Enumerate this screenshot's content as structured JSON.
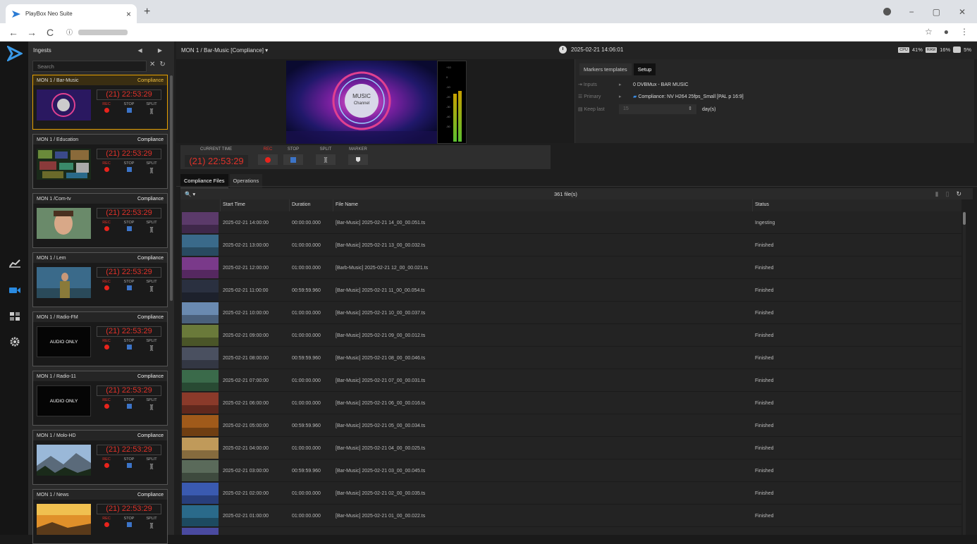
{
  "browser": {
    "tab_title": "PlayBox Neo Suite",
    "new_tab": "+",
    "close_tab": "×",
    "back": "←",
    "forward": "→",
    "reload": "C",
    "info": "ⓘ",
    "minimize": "−",
    "restore": "▢",
    "close": "✕",
    "star": "☆",
    "menu": "⋮"
  },
  "ingests": {
    "title": "Ingests",
    "arrows": "◀ ▶",
    "search_placeholder": "Search",
    "rec_label": "REC",
    "stop_label": "STOP",
    "split_label": "SPLIT",
    "split_symbol": "][",
    "cards": [
      {
        "name": "MON 1 / Bar-Music",
        "mode": "Compliance",
        "timer": "(21) 22:53:29",
        "active": true,
        "audio_only": false,
        "thumb": "music"
      },
      {
        "name": "MON 1 / Education",
        "mode": "Compliance",
        "timer": "(21) 22:53:29",
        "active": false,
        "audio_only": false,
        "thumb": "mosaic"
      },
      {
        "name": "MON 1 /Com-tv",
        "mode": "Compliance",
        "timer": "(21) 22:53:29",
        "active": false,
        "audio_only": false,
        "thumb": "face"
      },
      {
        "name": "MON 1 / Lem",
        "mode": "Compliance",
        "timer": "(21) 22:53:29",
        "active": false,
        "audio_only": false,
        "thumb": "presenter"
      },
      {
        "name": "MON 1 / Radio-FM",
        "mode": "Compliance",
        "timer": "(21) 22:53:29",
        "active": false,
        "audio_only": true,
        "audio_text": "AUDIO ONLY"
      },
      {
        "name": "MON 1 / Radio-11",
        "mode": "Compliance",
        "timer": "(21) 22:53:29",
        "active": false,
        "audio_only": true,
        "audio_text": "AUDIO ONLY"
      },
      {
        "name": "MON 1 / Molo-HD",
        "mode": "Compliance",
        "timer": "(21) 22:53:29",
        "active": false,
        "audio_only": false,
        "thumb": "mountains"
      },
      {
        "name": "MON 1 / News",
        "mode": "Compliance",
        "timer": "(21) 22:53:29",
        "active": false,
        "audio_only": false,
        "thumb": "sunset"
      }
    ]
  },
  "main": {
    "channel_title": "MON 1 / Bar-Music  [Compliance]  ▾",
    "datetime": "2025-02-21 14:06:01",
    "stats": {
      "cpu_badge": "CPU",
      "cpu": "41%",
      "ram_badge": "RAM",
      "ram": "16%",
      "disk": "5%"
    },
    "video_logo": "MUSIC Channel",
    "meter_scale": [
      "+10",
      "0",
      "-10",
      "-20",
      "-30",
      "-40",
      "-50"
    ]
  },
  "setup": {
    "tabs": [
      "Markers templates",
      "Setup"
    ],
    "active_tab": "Setup",
    "inputs_label": "Inputs",
    "inputs_value": "0 DVBMux - BAR MUSIC",
    "primary_label": "Primary",
    "primary_value": "Compliance: NV H264 25fps_Small [PAL p 16:9]",
    "keep_last_label": "Keep last",
    "keep_last_value": "15",
    "keep_last_unit": "day(s)"
  },
  "transport": {
    "current_time_label": "CURRENT TIME",
    "current_time": "(21) 22:53:29",
    "rec_label": "REC",
    "stop_label": "STOP",
    "split_label": "SPLIT",
    "marker_label": "MARKER",
    "split_symbol": "]["
  },
  "files": {
    "tabs": [
      "Compliance Files",
      "Operations"
    ],
    "active_tab": "Compliance Files",
    "search_icon": "🔍 ▾",
    "count": "361 file(s)",
    "columns": [
      "Start Time",
      "Duration",
      "File Name",
      "Status"
    ],
    "rows": [
      {
        "start": "2025-02-21 14:00:00",
        "duration": "00:00:00.000",
        "file": "[Bar-Music] 2025-02-21 14_00_00.051.ts",
        "status": "Ingesting",
        "thumb": "#5b3a6a"
      },
      {
        "start": "2025-02-21 13:00:00",
        "duration": "01:00:00.000",
        "file": "[Bar-Music] 2025-02-21 13_00_00.032.ts",
        "status": "Finished",
        "thumb": "#3a6a8a"
      },
      {
        "start": "2025-02-21 12:00:00",
        "duration": "01:00:00.000",
        "file": "[Barb-Music] 2025-02-21 12_00_00.021.ts",
        "status": "Finished",
        "thumb": "#7a3a8a"
      },
      {
        "start": "2025-02-21 11:00:00",
        "duration": "00:59:59.960",
        "file": "[Bar-Music] 2025-02-21 11_00_00.054.ts",
        "status": "Finished",
        "thumb": "#2a3040"
      },
      {
        "start": "2025-02-21 10:00:00",
        "duration": "01:00:00.000",
        "file": "[Bar-Music] 2025-02-21 10_00_00.037.ts",
        "status": "Finished",
        "thumb": "#6a8ab0"
      },
      {
        "start": "2025-02-21 09:00:00",
        "duration": "01:00:00.000",
        "file": "[Bar-Music] 2025-02-21 09_00_00.012.ts",
        "status": "Finished",
        "thumb": "#6a7a3a"
      },
      {
        "start": "2025-02-21 08:00:00",
        "duration": "00:59:59.960",
        "file": "[Bar-Music] 2025-02-21 08_00_00.046.ts",
        "status": "Finished",
        "thumb": "#4a5060"
      },
      {
        "start": "2025-02-21 07:00:00",
        "duration": "01:00:00.000",
        "file": "[Bar-Music] 2025-02-21 07_00_00.031.ts",
        "status": "Finished",
        "thumb": "#3a6a4a"
      },
      {
        "start": "2025-02-21 06:00:00",
        "duration": "01:00:00.000",
        "file": "[Bar-Music] 2025-02-21 06_00_00.016.ts",
        "status": "Finished",
        "thumb": "#8a3a2a"
      },
      {
        "start": "2025-02-21 05:00:00",
        "duration": "00:59:59.960",
        "file": "[Bar-Music] 2025-02-21 05_00_00.034.ts",
        "status": "Finished",
        "thumb": "#a05a1a"
      },
      {
        "start": "2025-02-21 04:00:00",
        "duration": "01:00:00.000",
        "file": "[Bar-Music] 2025-02-21 04_00_00.025.ts",
        "status": "Finished",
        "thumb": "#c09a5a"
      },
      {
        "start": "2025-02-21 03:00:00",
        "duration": "00:59:59.960",
        "file": "[Bar-Music] 2025-02-21 03_00_00.045.ts",
        "status": "Finished",
        "thumb": "#5a6a5a"
      },
      {
        "start": "2025-02-21 02:00:00",
        "duration": "01:00:00.000",
        "file": "[Bar-Music] 2025-02-21 02_00_00.035.ts",
        "status": "Finished",
        "thumb": "#3a5ab0"
      },
      {
        "start": "2025-02-21 01:00:00",
        "duration": "01:00:00.000",
        "file": "[Bar-Music] 2025-02-21 01_00_00.022.ts",
        "status": "Finished",
        "thumb": "#2a6a8a"
      },
      {
        "start": "",
        "duration": "",
        "file": "",
        "status": "",
        "thumb": "#4a4aa0"
      }
    ]
  },
  "leftbar": {
    "icons": [
      "chart-icon",
      "camera-icon",
      "layout-icon",
      "gear-icon"
    ]
  }
}
